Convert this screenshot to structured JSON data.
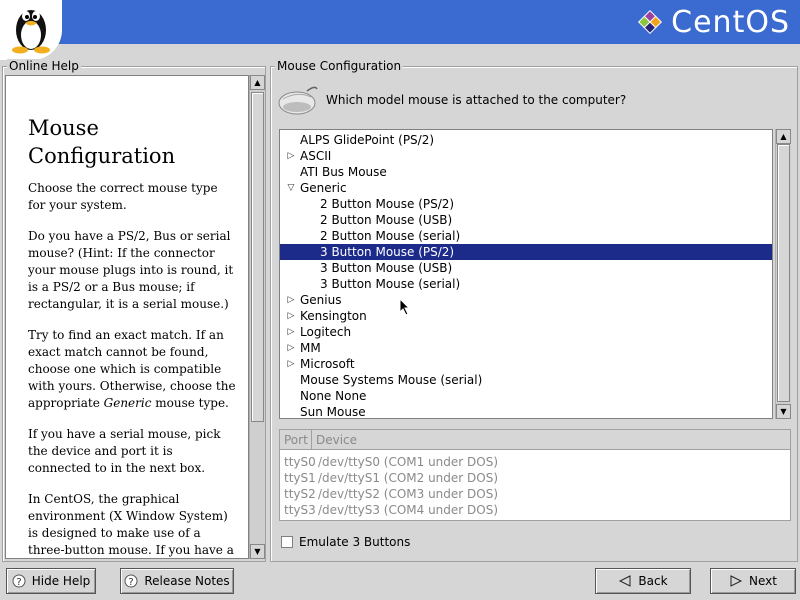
{
  "header": {
    "brand_name": "CentOS",
    "colors": {
      "bar": "#3b6bd0",
      "logo_purple": "#9b3fa0",
      "logo_green": "#8cc63f",
      "logo_orange": "#f2a31b",
      "logo_blue": "#262577"
    }
  },
  "help": {
    "frame_title": "Online Help",
    "title_line1": "Mouse",
    "title_line2": "Configuration",
    "p1": "Choose the correct mouse type for your system.",
    "p2": "Do you have a PS/2, Bus or serial mouse? (Hint: If the connector your mouse plugs into is round, it is a PS/2 or a Bus mouse; if rectangular, it is a serial mouse.)",
    "p3_before": "Try to find an exact match. If an exact match cannot be found, choose one which is compatible with yours. Otherwise, choose the appropriate ",
    "p3_em": "Generic",
    "p3_after": " mouse type.",
    "p4": "If you have a serial mouse, pick the device and port it is connected to in the next box.",
    "p5": "In CentOS, the graphical environment (X Window System) is designed to make use of a three-button mouse. If you have a"
  },
  "config": {
    "frame_title": "Mouse Configuration",
    "prompt": "Which model mouse is attached to the computer?",
    "tree": [
      {
        "label": "ALPS GlidePoint (PS/2)",
        "level": 0,
        "expander": "none"
      },
      {
        "label": "ASCII",
        "level": 0,
        "expander": "collapsed"
      },
      {
        "label": "ATI Bus Mouse",
        "level": 0,
        "expander": "none"
      },
      {
        "label": "Generic",
        "level": 0,
        "expander": "expanded"
      },
      {
        "label": "2 Button Mouse (PS/2)",
        "level": 1,
        "expander": "none"
      },
      {
        "label": "2 Button Mouse (USB)",
        "level": 1,
        "expander": "none"
      },
      {
        "label": "2 Button Mouse (serial)",
        "level": 1,
        "expander": "none"
      },
      {
        "label": "3 Button Mouse (PS/2)",
        "level": 1,
        "expander": "none",
        "selected": true
      },
      {
        "label": "3 Button Mouse (USB)",
        "level": 1,
        "expander": "none"
      },
      {
        "label": "3 Button Mouse (serial)",
        "level": 1,
        "expander": "none"
      },
      {
        "label": "Genius",
        "level": 0,
        "expander": "collapsed"
      },
      {
        "label": "Kensington",
        "level": 0,
        "expander": "collapsed"
      },
      {
        "label": "Logitech",
        "level": 0,
        "expander": "collapsed"
      },
      {
        "label": "MM",
        "level": 0,
        "expander": "collapsed"
      },
      {
        "label": "Microsoft",
        "level": 0,
        "expander": "collapsed"
      },
      {
        "label": "Mouse Systems Mouse (serial)",
        "level": 0,
        "expander": "none"
      },
      {
        "label": "None None",
        "level": 0,
        "expander": "none"
      },
      {
        "label": "Sun Mouse",
        "level": 0,
        "expander": "none"
      }
    ],
    "ports": {
      "headers": [
        "Port",
        "Device"
      ],
      "rows": [
        {
          "port": "ttyS0",
          "device": "/dev/ttyS0 (COM1 under DOS)"
        },
        {
          "port": "ttyS1",
          "device": "/dev/ttyS1 (COM2 under DOS)"
        },
        {
          "port": "ttyS2",
          "device": "/dev/ttyS2 (COM3 under DOS)"
        },
        {
          "port": "ttyS3",
          "device": "/dev/ttyS3 (COM4 under DOS)"
        }
      ]
    },
    "emulate_label": "Emulate 3 Buttons",
    "selection_color": "#1c2a8a"
  },
  "buttons": {
    "hide_help": "Hide Help",
    "release_notes": "Release Notes",
    "back": "Back",
    "next": "Next"
  }
}
